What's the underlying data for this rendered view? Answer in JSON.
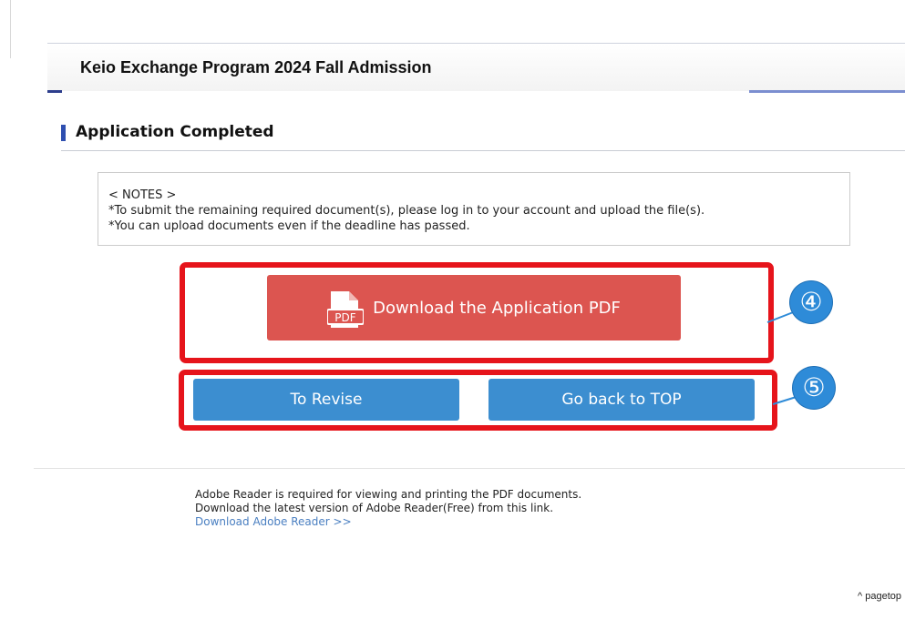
{
  "header": {
    "program_title": "Keio Exchange Program 2024 Fall Admission"
  },
  "section": {
    "heading": "Application Completed"
  },
  "notes": {
    "title": "< NOTES >",
    "lines": [
      "*To submit the remaining required document(s), please log in to your account and upload the file(s).",
      "*You can upload documents even if the deadline has passed."
    ]
  },
  "actions": {
    "download_pdf_label": "Download the Application PDF",
    "pdf_icon_text": "PDF",
    "revise_label": "To Revise",
    "back_to_top_label": "Go back to TOP"
  },
  "annotations": {
    "badge_4": "④",
    "badge_5": "⑤"
  },
  "footer": {
    "line1": "Adobe Reader is required for viewing and printing the PDF documents.",
    "line2": "Download the latest version of Adobe Reader(Free) from this link.",
    "link_text": "Download Adobe Reader >>",
    "pagetop_label": "^ pagetop"
  },
  "colors": {
    "pdf_button": "#dc5550",
    "blue_button": "#3c8ed0",
    "callout_red": "#e6141b",
    "badge_blue": "#2e8bd8",
    "heading_accent": "#2f4fb0"
  }
}
